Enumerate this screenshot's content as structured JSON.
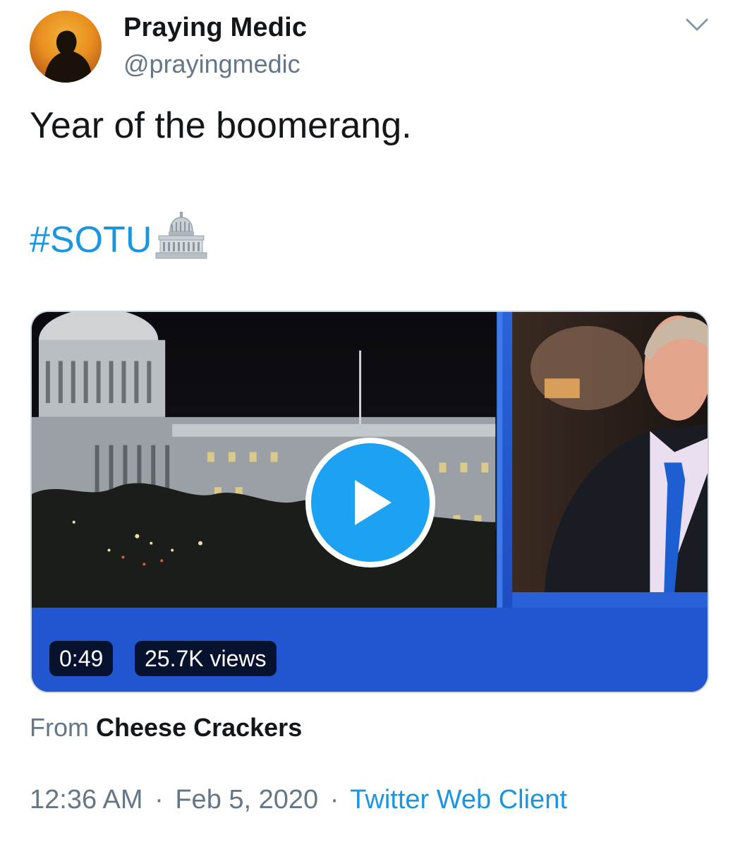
{
  "author": {
    "display_name": "Praying Medic",
    "handle": "@prayingmedic",
    "avatar_icon": "silhouette-avatar"
  },
  "tweet": {
    "text": "Year of the boomerang.",
    "hashtag": "#SOTU",
    "hashtag_emoji": "classical-building-emoji"
  },
  "media": {
    "type": "video",
    "duration": "0:49",
    "views": "25.7K views",
    "play_icon": "play-icon"
  },
  "attribution": {
    "prefix": "From",
    "source": "Cheese Crackers"
  },
  "meta": {
    "time": "12:36 AM",
    "date": "Feb 5, 2020",
    "client": "Twitter Web Client",
    "separator": "·"
  },
  "menu_icon": "chevron-down-icon",
  "colors": {
    "link": "#1b95e0",
    "secondary_text": "#657786",
    "primary_text": "#14171a",
    "play_button": "#1da1f2"
  }
}
